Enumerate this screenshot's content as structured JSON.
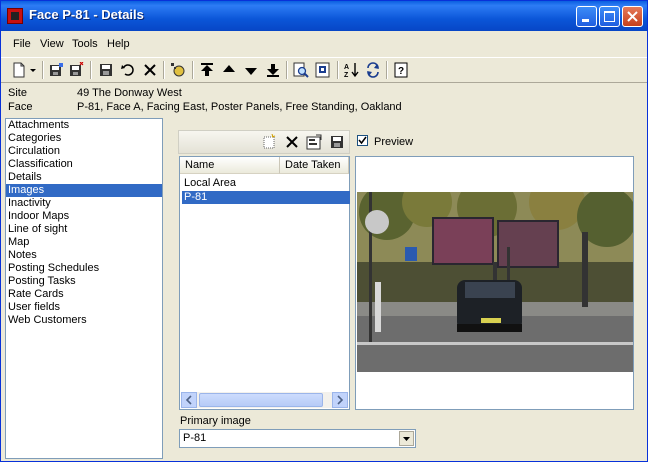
{
  "window": {
    "title": "Face P-81 - Details"
  },
  "menu": {
    "file": "File",
    "view": "View",
    "tools": "Tools",
    "help": "Help"
  },
  "info": {
    "site_label": "Site",
    "site_value": "49 The Donway West",
    "face_label": "Face",
    "face_value": "P-81, Face A, Facing East, Poster Panels, Free Standing, Oakland"
  },
  "left_list": {
    "selected_index": 5,
    "items": [
      "Attachments",
      "Categories",
      "Circulation",
      "Classification",
      "Details",
      "Images",
      "Inactivity",
      "Indoor Maps",
      "Line of sight",
      "Map",
      "Notes",
      "Posting Schedules",
      "Posting Tasks",
      "Rate Cards",
      "User fields",
      "Web Customers"
    ]
  },
  "images": {
    "preview_label": "Preview",
    "preview_checked": true,
    "columns": [
      "Name",
      "Date Taken"
    ],
    "rows": [
      "Local Area",
      "P-81"
    ],
    "selected_row": 1,
    "primary_label": "Primary image",
    "primary_value": "P-81"
  },
  "colors": {
    "selection": "#316ac5",
    "titlebar": "#0b56d8",
    "face": "#ece9d8"
  }
}
